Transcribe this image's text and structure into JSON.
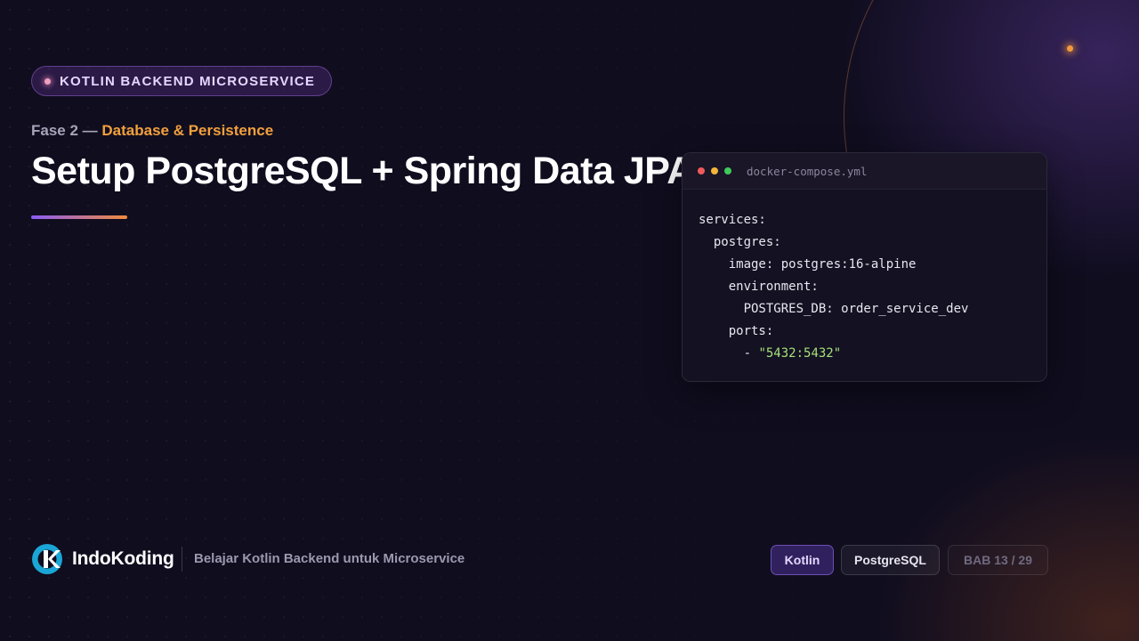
{
  "badge": {
    "label": "KOTLIN BACKEND MICROSERVICE"
  },
  "phase": {
    "label": "Fase 2 —",
    "topic": "Database & Persistence"
  },
  "title": "Setup PostgreSQL + Spring Data JPA",
  "code_window": {
    "filename": "docker-compose.yml",
    "lines": [
      "services:",
      "  postgres:",
      "    image: postgres:16-alpine",
      "    environment:",
      "      POSTGRES_DB: order_service_dev",
      "    ports:",
      "      - "
    ],
    "port_string": "\"5432:5432\""
  },
  "footer": {
    "brand": "IndoKoding",
    "tagline": "Belajar Kotlin Backend untuk Microservice",
    "tags": [
      "Kotlin",
      "PostgreSQL"
    ],
    "chapter": "BAB 13 / 29"
  },
  "colors": {
    "accent_orange": "#f2a03c",
    "accent_purple": "#8b5cf6",
    "string_green": "#a6e07a",
    "background": "#100d1f"
  },
  "icons": [
    "indokoding-logo-icon"
  ]
}
